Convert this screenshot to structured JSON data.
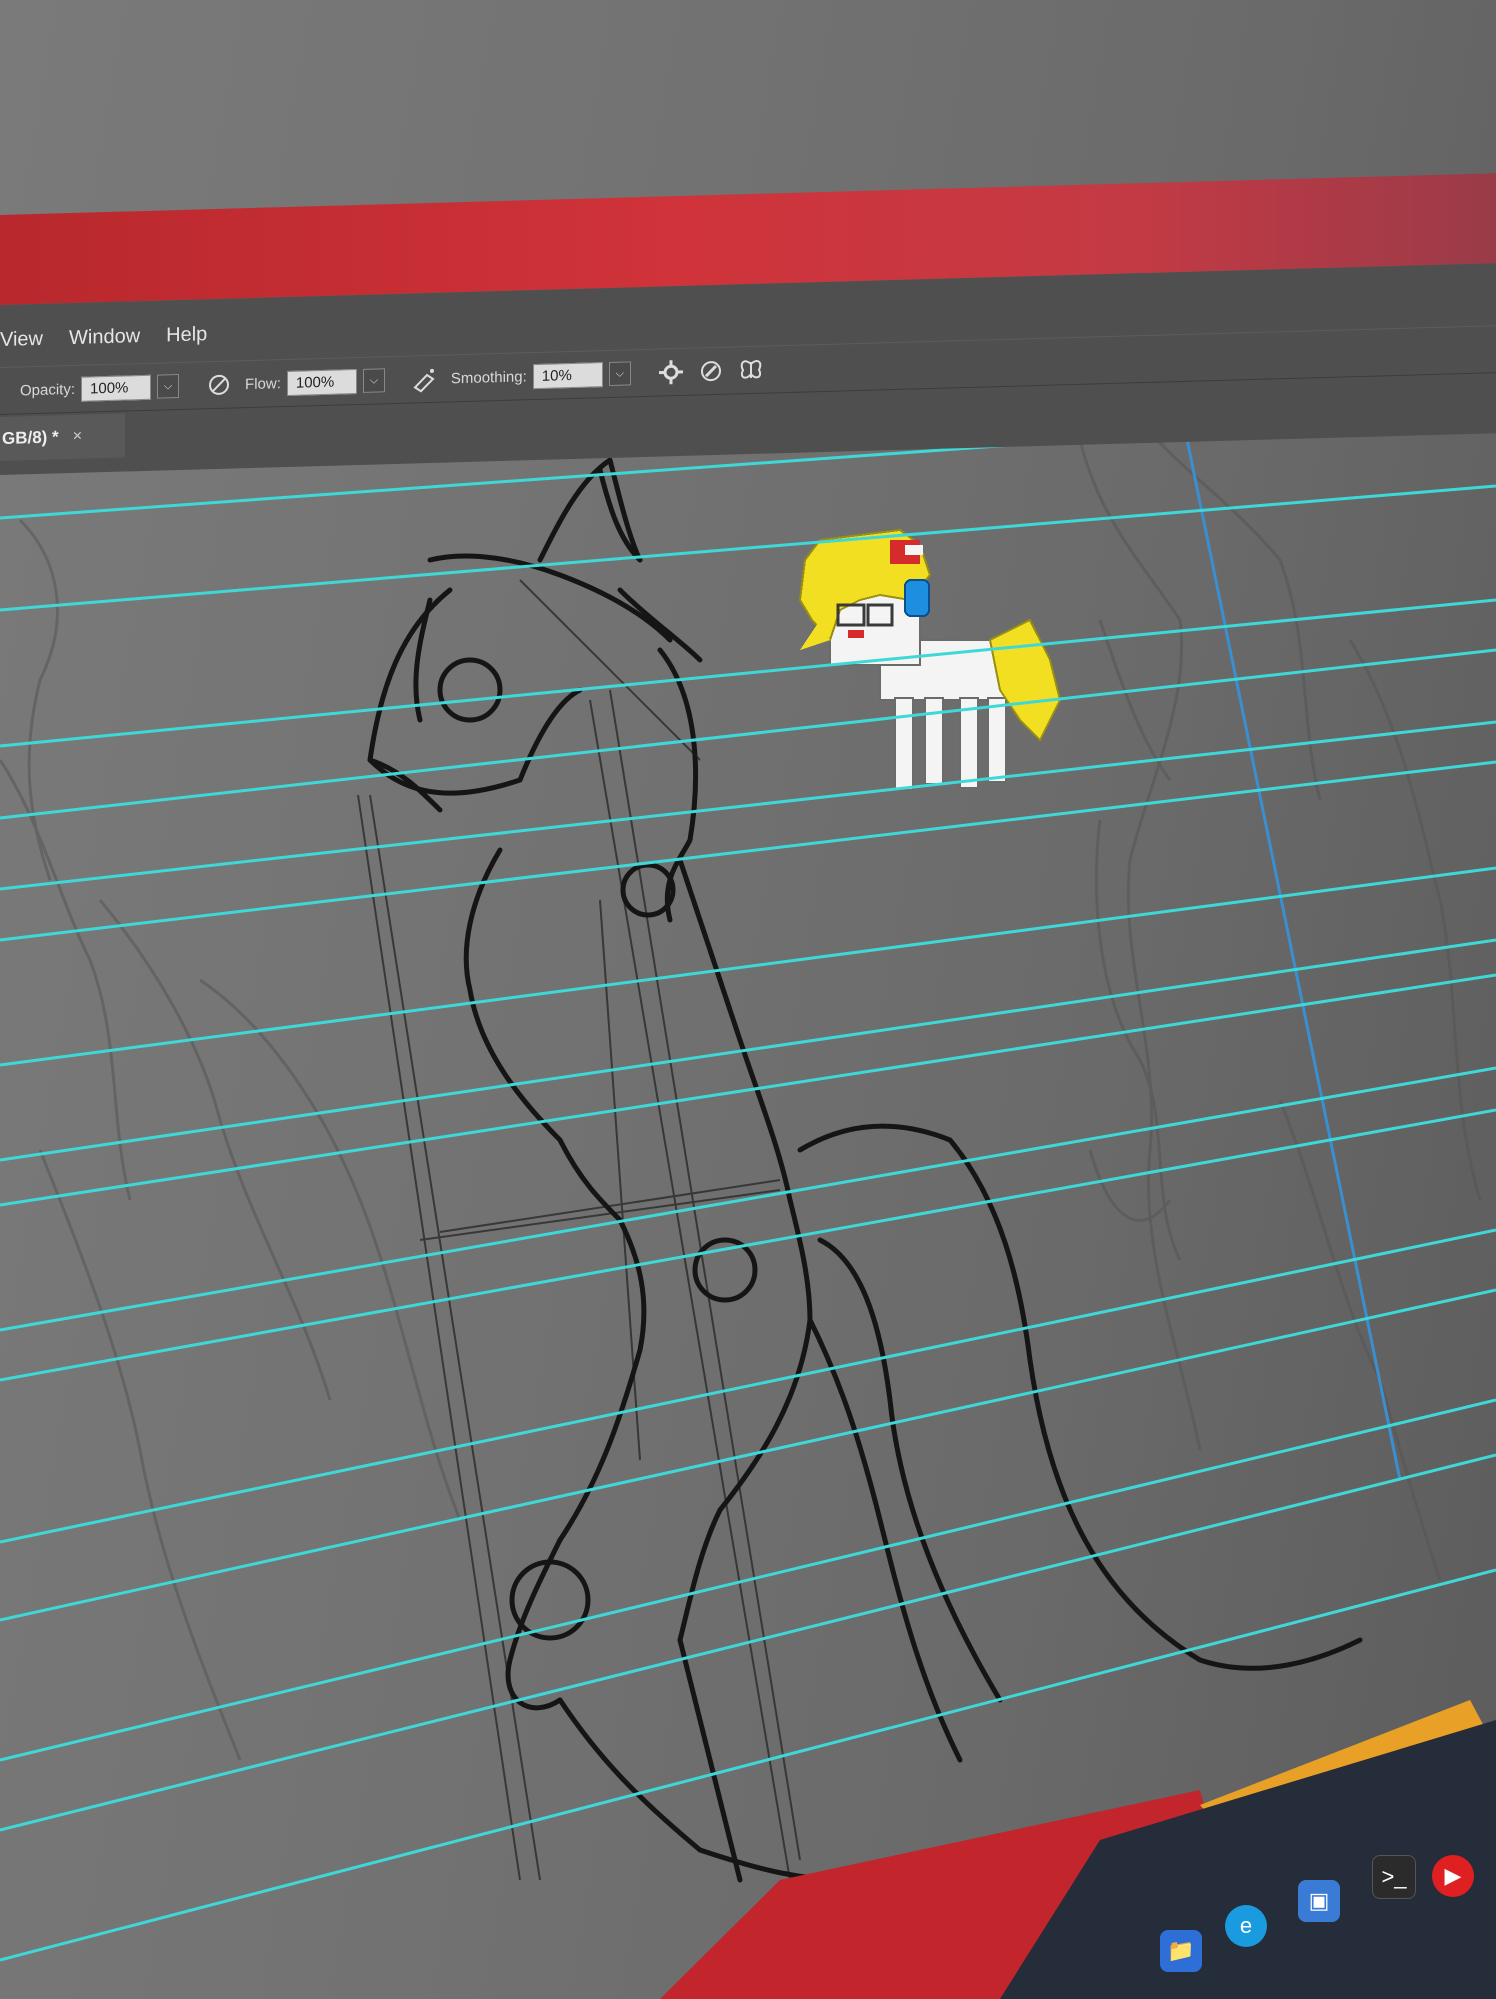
{
  "app": {
    "menu": [
      "View",
      "Window",
      "Help"
    ],
    "options_bar": {
      "opacity_label": "Opacity:",
      "opacity_value": "100%",
      "flow_label": "Flow:",
      "flow_value": "100%",
      "smoothing_label": "Smoothing:",
      "smoothing_value": "10%"
    },
    "document_tab": {
      "title": "GB/8) *",
      "close_glyph": "×"
    }
  },
  "colors": {
    "guide": "#3fd8d8",
    "titlebar": "#c8303a",
    "panel": "#4f4f4f",
    "canvas": "#727272",
    "pony_mane": "#f2df22",
    "pony_body": "#f4f4f4",
    "headphones": "#1e8fe0"
  },
  "icons": [
    "airbrush-icon",
    "pressure-opacity-icon",
    "smoothing-settings-gear-icon",
    "pressure-size-icon",
    "symmetry-butterfly-icon",
    "edge-browser-icon",
    "store-icon",
    "terminal-icon",
    "youtube-music-icon"
  ]
}
